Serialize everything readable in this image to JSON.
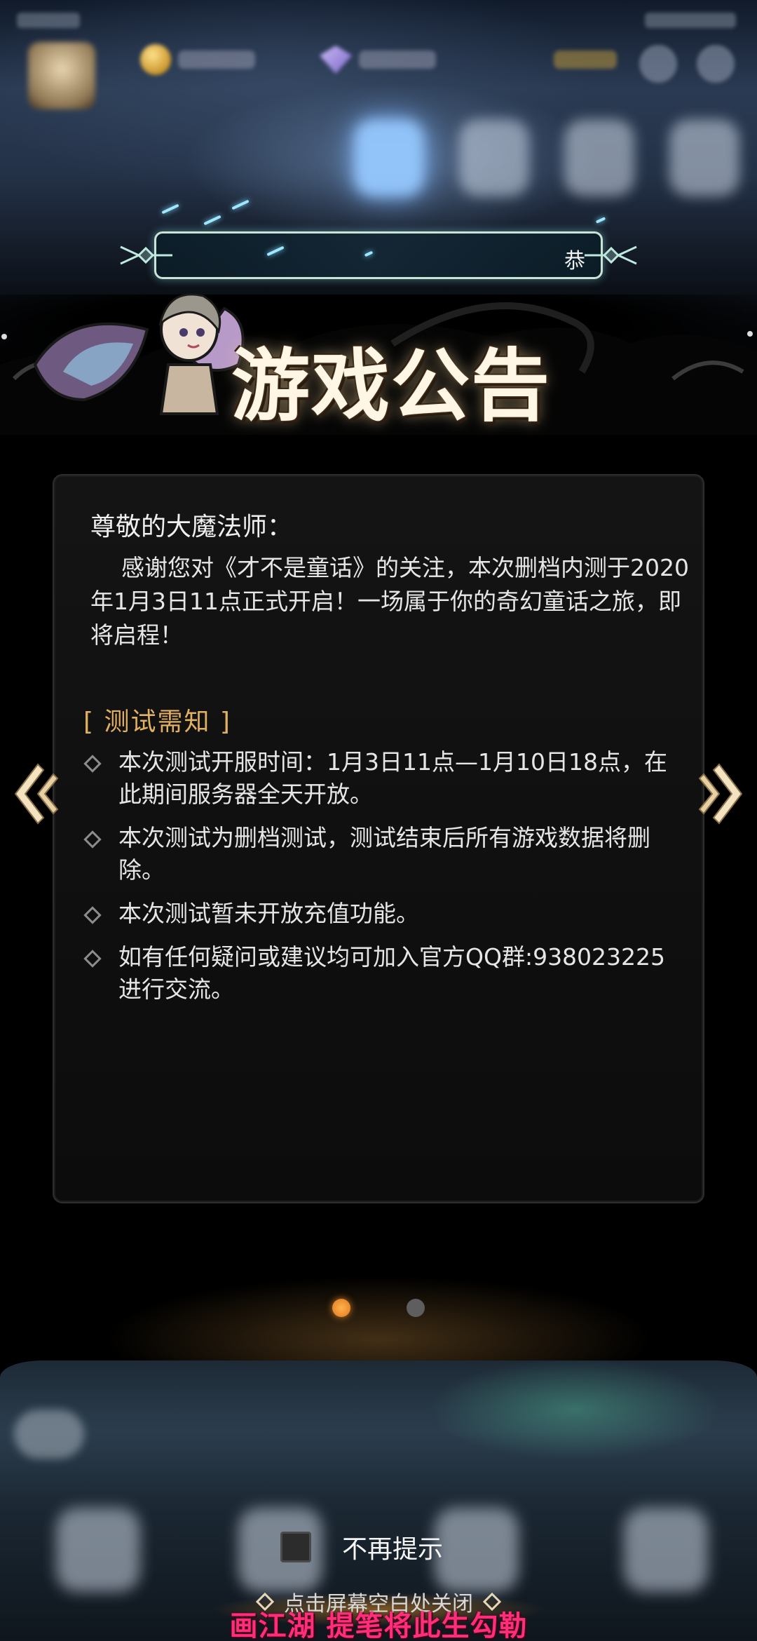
{
  "banner": {
    "title": "游戏公告"
  },
  "marquee": {
    "text": "恭"
  },
  "notice": {
    "greeting": "尊敬的大魔法师：",
    "intro": "感谢您对《才不是童话》的关注，本次删档内测于2020年1月3日11点正式开启！一场属于你的奇幻童话之旅，即将启程！",
    "section_title": "[ 测试需知 ]",
    "bullets": [
      "本次测试开服时间：1月3日11点—1月10日18点，在此期间服务器全天开放。",
      "本次测试为删档测试，测试结束后所有游戏数据将删除。",
      "本次测试暂未开放充值功能。",
      "如有任何疑问或建议均可加入官方QQ群:938023225进行交流。"
    ]
  },
  "pagination": {
    "total": 2,
    "active_index": 0
  },
  "footer": {
    "no_remind_label": "不再提示",
    "no_remind_checked": false,
    "close_hint": "点击屏幕空白处关闭"
  },
  "caption": "画江湖 提笔将此生勾勒",
  "icons": {
    "prev": "double-chevron-left-icon",
    "next": "double-chevron-right-icon",
    "diamond": "diamond-bullet-icon"
  },
  "colors": {
    "accent_gold": "#e2b062",
    "active_dot": "#ffb24f",
    "caption": "#ff2d7a"
  }
}
